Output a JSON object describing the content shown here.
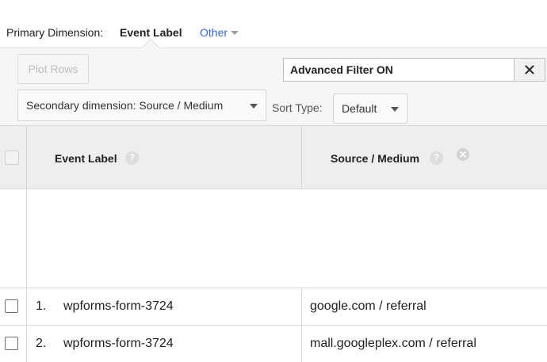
{
  "primary_dimension": {
    "label": "Primary Dimension:",
    "active": "Event Label",
    "other": "Other"
  },
  "controls": {
    "plot_rows": "Plot Rows",
    "advanced_filter": "Advanced Filter ON",
    "secondary_dimension": "Secondary dimension: Source / Medium",
    "sort_type_label": "Sort Type:",
    "sort_type_value": "Default"
  },
  "table": {
    "columns": [
      "Event Label",
      "Source / Medium"
    ],
    "help_glyph": "?",
    "rows": [
      {
        "num": "1.",
        "label": "wpforms-form-3724",
        "source": "google.com / referral"
      },
      {
        "num": "2.",
        "label": "wpforms-form-3724",
        "source": "mall.googleplex.com / referral"
      }
    ]
  },
  "colors": {
    "link_blue": "#3367d6",
    "header_bg": "#eeeeee",
    "controls_bg": "#f6f6f6"
  },
  "icons": {
    "filter_close": "close-icon",
    "help": "help-icon",
    "remove_dimension": "remove-circle-icon",
    "dropdown": "caret-down-icon"
  }
}
